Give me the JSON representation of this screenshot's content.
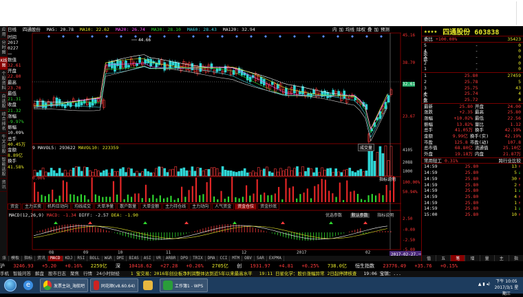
{
  "vtabs": [
    "应用",
    "分时图",
    "K线图",
    "个股资料",
    "自选股",
    "综合排名",
    "牛叉诊股",
    "智能选股",
    "资讯"
  ],
  "vtab_active": 2,
  "title": {
    "period": "日线",
    "name": "四通股份",
    "ma5": "MA5: 20.78",
    "ma10": "MA10: 22.62",
    "ma20": "MA20: 26.74",
    "ma30": "MA30: 28.10",
    "ma60": "MA60: 28.43",
    "ma120": "MA120: 32.94",
    "tools": [
      "内",
      "加",
      "均线",
      "除权",
      "叠",
      "加",
      "预测"
    ]
  },
  "info": {
    "time_label": "时间",
    "date1": "2017",
    "date2": "0227",
    "date3": "一",
    "val_label": "数值",
    "val": "32.61",
    "open_label": "开盘",
    "open": "22.80",
    "high_label": "最高",
    "high": "23.70",
    "low_label": "最低",
    "low": "21.31",
    "close_label": "收盘",
    "close": "21.32",
    "chg_label": "涨幅",
    "chg": "-9.97%",
    "amp_label": "振幅",
    "amp": "10.09%",
    "vol_label": "总手",
    "vol": "40.45万",
    "amt_label": "金额",
    "amt": "8.89亿",
    "turn_label": "换手",
    "turn": "41.58%"
  },
  "price_scale": [
    "45.16",
    "38.70",
    "32.61",
    "23.67"
  ],
  "peak_label": "44.66",
  "vol_bar": {
    "vol": "9",
    "mavol5": "MAVOL5: 293622",
    "mavol10": "MAVOL10: 223359",
    "btn": "成交量"
  },
  "vol_scale": [
    "4105",
    "2088",
    "1000"
  ],
  "vol_indicator_btn": "指标说明",
  "ratio_label": "0.00%",
  "ratio_scale": [
    "100.00%",
    "50.94%"
  ],
  "subtabs": [
    "资金",
    "主力买卖",
    "机构日动向",
    "均线成交",
    "大单净量",
    "散户数量",
    "大单金额",
    "主力持仓线",
    "主力动向",
    "人气资金",
    "资金仓位",
    "资金抄底"
  ],
  "subtab_active": 10,
  "macd_btns": [
    "优选参数",
    "默认参数",
    "指标说明"
  ],
  "macd": {
    "label": "MACD(12,26,9)",
    "macd": "MACD: -1.34",
    "diff": "DIFF: -2.57",
    "dea": "DEA: -1.90"
  },
  "macd_scale": [
    "2.50",
    "-0.00",
    "-2.50",
    "-5.00"
  ],
  "months": [
    "08",
    "09",
    "10",
    "11",
    "12",
    "2017",
    "02"
  ],
  "cursor_date": "2017-02-27,一",
  "funcbar": [
    "MACD",
    "KDJ",
    "RSI",
    "BOLL",
    "W&R",
    "DMI",
    "BIAS",
    "ASI",
    "VR",
    "ARBR",
    "DPO",
    "TRIX",
    "DMA",
    "CCI",
    "MTM",
    "OBV",
    "SAR",
    "EXPMA"
  ],
  "funcbar_left": [
    "涨",
    "模板",
    "指标",
    "资讯"
  ],
  "side": {
    "stars": "★★★★",
    "name": "四通股份 603838",
    "weibi_label": "委比",
    "weibi": "+100.00%",
    "weicha": "35423",
    "sell": [
      [
        "5",
        "-",
        "0"
      ],
      [
        "4",
        "-",
        "0"
      ],
      [
        "3",
        "-",
        "0"
      ],
      [
        "2",
        "-",
        "0"
      ],
      [
        "1",
        "-",
        "0"
      ]
    ],
    "buy": [
      [
        "1",
        "25.80",
        "27459"
      ],
      [
        "2",
        "25.78",
        "5"
      ],
      [
        "3",
        "25.75",
        "43"
      ],
      [
        "4",
        "25.74",
        "4"
      ],
      [
        "5",
        "25.72",
        "4"
      ]
    ],
    "sell_label": "卖盘",
    "buy_label": "买盘",
    "stats": [
      [
        "最新",
        "25.80",
        "开盘",
        "24.00"
      ],
      [
        "涨跌",
        "+2.35",
        "最高",
        "25.80"
      ],
      [
        "涨幅",
        "+10.02%",
        "最低",
        "22.56"
      ],
      [
        "振幅",
        "13.82%",
        "量比",
        "1.12"
      ],
      [
        "总手",
        "41.05万",
        "换手",
        "42.19%"
      ],
      [
        "金额",
        "9.99亿",
        "换手(实)",
        "42.19%"
      ],
      [
        "市盈",
        "125.8",
        "市盈(动)",
        "107.8"
      ],
      [
        "总市值",
        "68.80亿",
        "流通值",
        "25.10亿"
      ],
      [
        "外盘",
        "19.18万",
        "内盘",
        "21.87万"
      ]
    ],
    "tabs": [
      "常用轻工",
      "0.31%",
      "跨行业比较"
    ],
    "ticks": [
      [
        "14:59",
        "25.80",
        "13"
      ],
      [
        "14:59",
        "25.80",
        "5"
      ],
      [
        "14:59",
        "25.80",
        "30"
      ],
      [
        "14:59",
        "25.80",
        "2"
      ],
      [
        "14:59",
        "25.80",
        "1"
      ],
      [
        "14:59",
        "25.80",
        "4"
      ],
      [
        "14:59",
        "25.80",
        "1"
      ],
      [
        "14:59",
        "25.80",
        "1"
      ],
      [
        "15:00",
        "25.80",
        "10"
      ]
    ],
    "bottom_tabs": [
      "值",
      "五",
      "笔",
      "增",
      "量",
      "主",
      "指"
    ]
  },
  "quote": {
    "label": "沪",
    "index": "3246.93",
    "chg": "+5.20",
    "pct": "+0.16%",
    "amt": "2259亿",
    "label2": "深",
    "index2": "10418.62",
    "chg2": "+27.28",
    "pct2": "+0.26%",
    "amt2": "2705亿",
    "label3": "创",
    "index3": "1931.97",
    "chg3": "+4.81",
    "pct3": "+0.25%",
    "amt3": "738.0亿",
    "label4": "恒生指数",
    "index4": "23776.49",
    "chg4": "+35.76",
    "pct4": "+0.15%"
  },
  "ticker": {
    "items": [
      "手机",
      "智能问答",
      "解盘",
      "股市日志",
      "聚焦",
      "行情",
      "24小时财经"
    ],
    "news": "1 宝交易：2016年创业板净利润整体达到近5年以来最高水平",
    "news2": "19:11 日星化学：股价涨幅异常 2日起停牌核查",
    "news3": "19:06 宝钢：..."
  },
  "taskbar": {
    "apps": [
      "发票主站_海航吧",
      "同花顺(v8.60.64)",
      "工作簿1 - WPS"
    ],
    "time": "下午 10:05",
    "date": "2017/3/1 星期三"
  }
}
